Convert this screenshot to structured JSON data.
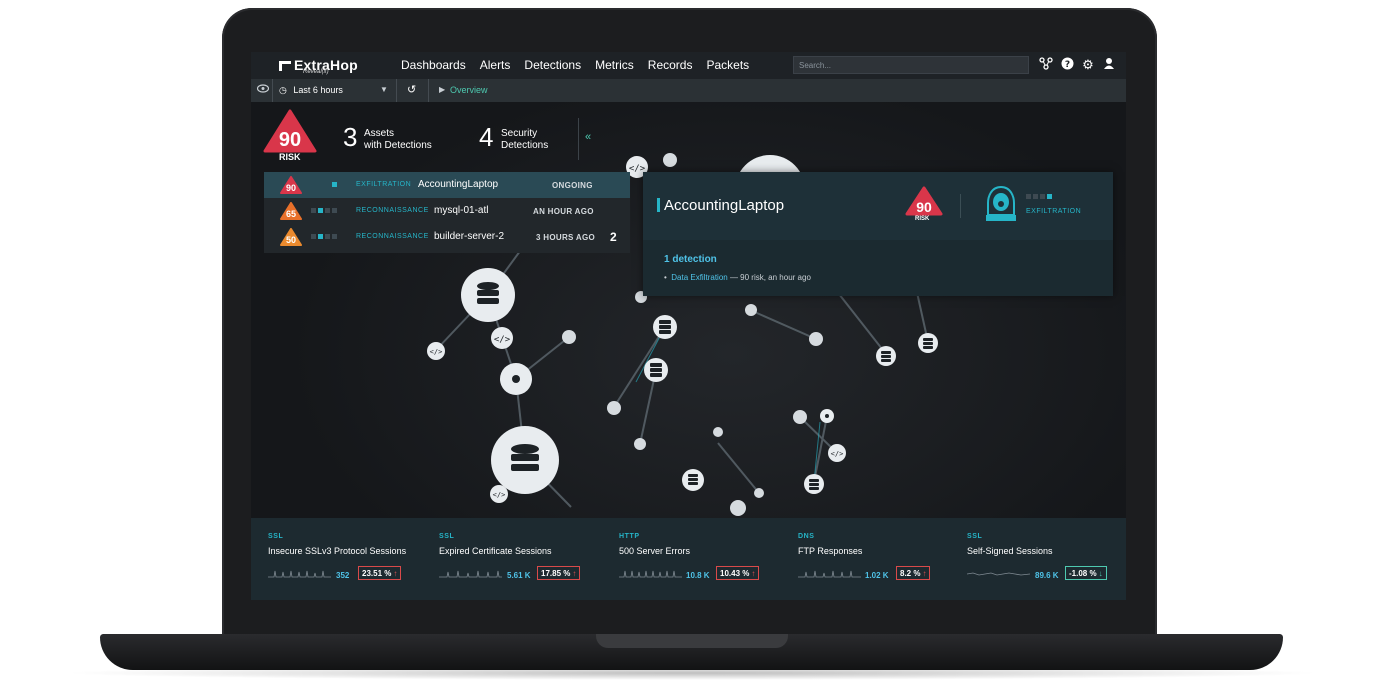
{
  "app": {
    "logo_text": "ExtraHop",
    "logo_sub": "Reveal(x)"
  },
  "nav": {
    "items": [
      "Dashboards",
      "Alerts",
      "Detections",
      "Metrics",
      "Records",
      "Packets"
    ],
    "search_placeholder": "Search...",
    "icons": [
      "topology-icon",
      "help-icon",
      "gear-icon",
      "user-icon"
    ]
  },
  "subbar": {
    "time_range": "Last 6 hours",
    "breadcrumb": "Overview"
  },
  "summary": {
    "risk_score": "90",
    "risk_label": "RISK",
    "assets_count": "3",
    "assets_label_1": "Assets",
    "assets_label_2": "with Detections",
    "security_count": "4",
    "security_label_1": "Security",
    "security_label_2": "Detections",
    "collapse_icon": "double-chevron-left-icon"
  },
  "detections": [
    {
      "risk": "90",
      "color": "#d9364a",
      "category": "EXFILTRATION",
      "asset": "AccountingLaptop",
      "when": "ONGOING",
      "count": "",
      "level": 1
    },
    {
      "risk": "65",
      "color": "#e8702a",
      "category": "RECONNAISSANCE",
      "asset": "mysql-01-atl",
      "when": "AN HOUR AGO",
      "count": "",
      "level": 2
    },
    {
      "risk": "50",
      "color": "#ea8a2e",
      "category": "RECONNAISSANCE",
      "asset": "builder-server-2",
      "when": "3 HOURS AGO",
      "count": "2",
      "level": 2
    }
  ],
  "detail_card": {
    "asset": "AccountingLaptop",
    "risk": "90",
    "risk_label": "RISK",
    "category": "EXFILTRATION",
    "detection_count": "1 detection",
    "detection_link": "Data Exfiltration",
    "detection_meta": "— 90 risk, an hour ago"
  },
  "metrics": [
    {
      "category": "SSL",
      "name": "Insecure SSLv3 Protocol Sessions",
      "value": "352",
      "change": "23.51 %",
      "direction": "up"
    },
    {
      "category": "SSL",
      "name": "Expired Certificate Sessions",
      "value": "5.61 K",
      "change": "17.85 %",
      "direction": "up"
    },
    {
      "category": "HTTP",
      "name": "500 Server Errors",
      "value": "10.8 K",
      "change": "10.43 %",
      "direction": "up"
    },
    {
      "category": "DNS",
      "name": "FTP Responses",
      "value": "1.02 K",
      "change": "8.2 %",
      "direction": "up"
    },
    {
      "category": "SSL",
      "name": "Self-Signed Sessions",
      "value": "89.6 K",
      "change": "-1.08 %",
      "direction": "down"
    }
  ],
  "colors": {
    "accent": "#26b5c8",
    "risk_red": "#d9364a",
    "risk_orange": "#e8702a",
    "bad": "#d94a4a",
    "good": "#4ec9b0"
  }
}
